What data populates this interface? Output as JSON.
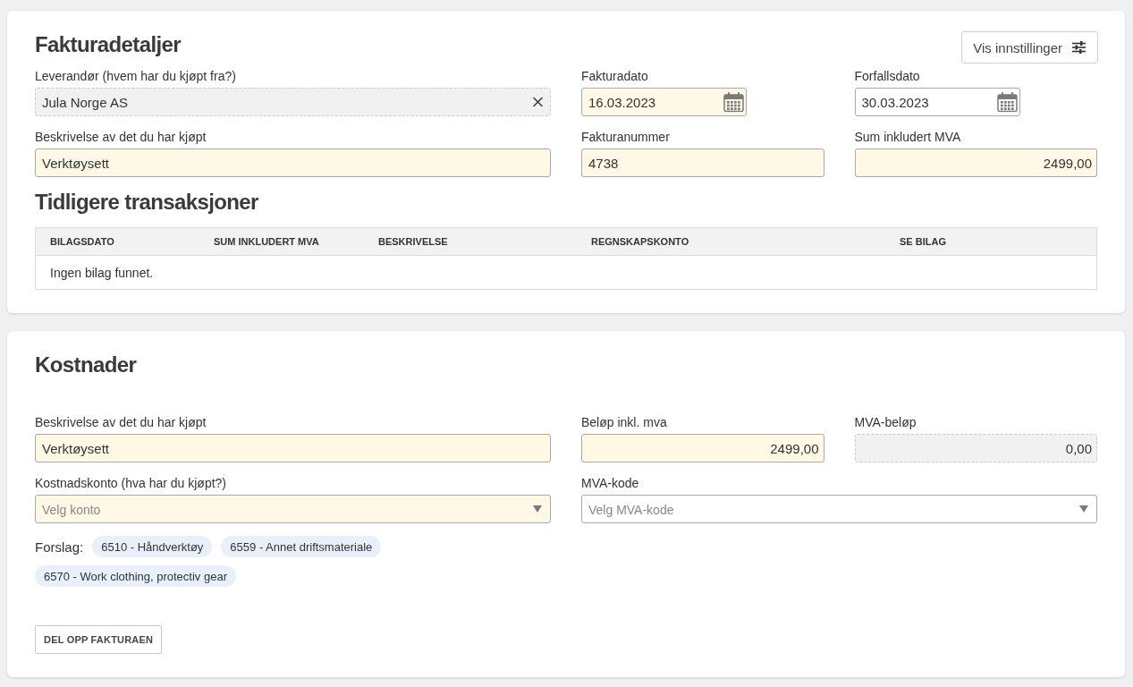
{
  "invoice_details": {
    "title": "Fakturadetaljer",
    "settings_button": "Vis innstillinger",
    "rows": [
      [
        {
          "kind": "lookup",
          "label": "Leverandør (hvem har du kjøpt fra?)",
          "value": "Jula Norge AS",
          "highlighted": false,
          "disabled": true
        },
        {
          "kind": "date",
          "label": "Fakturadato",
          "value": "16.03.2023",
          "highlighted": true,
          "disabled": false
        },
        {
          "kind": "date",
          "label": "Forfallsdato",
          "value": "30.03.2023",
          "highlighted": false,
          "disabled": false
        }
      ],
      [
        {
          "kind": "text",
          "label": "Beskrivelse av det du har kjøpt",
          "value": "Verktøysett",
          "highlighted": true,
          "disabled": false
        },
        {
          "kind": "text",
          "label": "Fakturanummer",
          "value": "4738",
          "highlighted": true,
          "disabled": false
        },
        {
          "kind": "amount",
          "label": "Sum inkludert MVA",
          "value": "2499,00",
          "highlighted": true,
          "disabled": false
        }
      ]
    ]
  },
  "previous_transactions": {
    "title": "Tidligere transaksjoner",
    "columns": [
      "BILAGSDATO",
      "SUM INKLUDERT MVA",
      "BESKRIVELSE",
      "REGNSKAPSKONTO",
      "SE BILAG"
    ],
    "empty_message": "Ingen bilag funnet."
  },
  "costs": {
    "title": "Kostnader",
    "rows": [
      [
        {
          "kind": "text",
          "label": "Beskrivelse av det du har kjøpt",
          "value": "Verktøysett",
          "highlighted": true,
          "disabled": false
        },
        {
          "kind": "amount",
          "label": "Beløp inkl. mva",
          "value": "2499,00",
          "highlighted": true,
          "disabled": false
        },
        {
          "kind": "amount",
          "label": "MVA-beløp",
          "value": "0,00",
          "highlighted": false,
          "disabled": true
        }
      ],
      [
        {
          "kind": "select",
          "label": "Kostnadskonto (hva har du kjøpt?)",
          "placeholder": "Velg konto",
          "highlighted": true,
          "disabled": false
        },
        {
          "kind": "select",
          "label": "MVA-kode",
          "placeholder": "Velg MVA-kode",
          "highlighted": false,
          "disabled": false
        }
      ]
    ],
    "suggestions": {
      "label": "Forslag:",
      "items": [
        "6510 - Håndverktøy",
        "6559 - Annet driftsmateriale",
        "6570 - Work clothing, protectiv gear"
      ]
    },
    "split_button": "DEL OPP FAKTURAEN"
  }
}
